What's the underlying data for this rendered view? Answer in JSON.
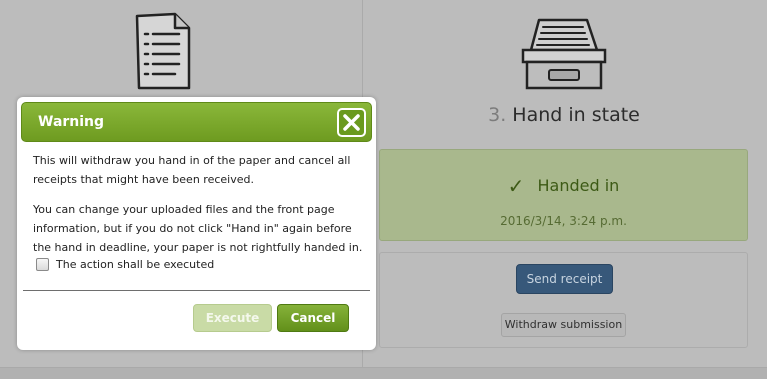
{
  "background": {
    "step": {
      "number": "3.",
      "title": "Hand in state"
    },
    "status": {
      "label": "Handed in",
      "date": "2016/3/14, 3:24 p.m.",
      "check_icon": "checkmark-icon"
    },
    "actions": {
      "send_receipt_label": "Send receipt",
      "withdraw_label": "Withdraw submission"
    },
    "icons": {
      "left_column_icon": "document-icon",
      "right_column_icon": "inbox-tray-icon"
    }
  },
  "modal": {
    "title": "Warning",
    "close_icon": "close-icon",
    "paragraph1": "This will withdraw you hand in of the paper and cancel all receipts that might have been received.",
    "paragraph2": "You can change your uploaded files and the front page information, but if you do not click \"Hand in\" again before the hand in deadline, your paper is not rightfully handed in.",
    "checkbox_label": "The action shall be executed",
    "checkbox_checked": false,
    "execute_label": "Execute",
    "cancel_label": "Cancel"
  },
  "colors": {
    "header_green": "#7aa82c",
    "execute_disabled": "#c9dba6",
    "send_receipt_blue": "#37587a",
    "overlay_gray": "#bcbcbc"
  }
}
